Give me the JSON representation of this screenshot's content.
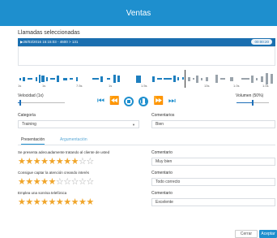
{
  "window": {
    "title": "Ventas"
  },
  "calls": {
    "section_title": "Llamadas seleccionadas",
    "selected": {
      "label": "▶28/03/2016 15:15:03 - 4600 > 131",
      "duration": "00:00:20"
    }
  },
  "timeline": {
    "ticks": [
      "1s",
      "1s",
      "7.5s",
      "1s",
      "1.5s",
      "13s",
      "1.0s",
      "1.0s"
    ]
  },
  "playback": {
    "speed_label": "Velocidad (1x)",
    "speed_value": 0.05,
    "volume_label": "Volumen (50%)",
    "volume_value": 0.5
  },
  "category": {
    "label": "Categoría",
    "value": "Training"
  },
  "comment_top": {
    "label": "Comentarios",
    "value": "Bien"
  },
  "tabs": [
    {
      "label": "Presentación",
      "active": true
    },
    {
      "label": "Argumentación",
      "active": false
    }
  ],
  "questions": [
    {
      "text": "Se presenta adecuadamente tratando al cliente de usted",
      "rating": 8,
      "max": 10,
      "comment_label": "Comentario",
      "comment": "Muy bien"
    },
    {
      "text": "Consigue captar la atención creando interés",
      "rating": 5,
      "max": 10,
      "comment_label": "Comentario",
      "comment": "Todo correcto"
    },
    {
      "text": "Emplea una sonrisa telefónica",
      "rating": 10,
      "max": 10,
      "comment_label": "Comentario",
      "comment": "Excelente"
    }
  ],
  "footer": {
    "cancel": "Cerrar",
    "accept": "Aceptar"
  },
  "colors": {
    "primary": "#1e8fce",
    "star": "#f0a52a"
  }
}
